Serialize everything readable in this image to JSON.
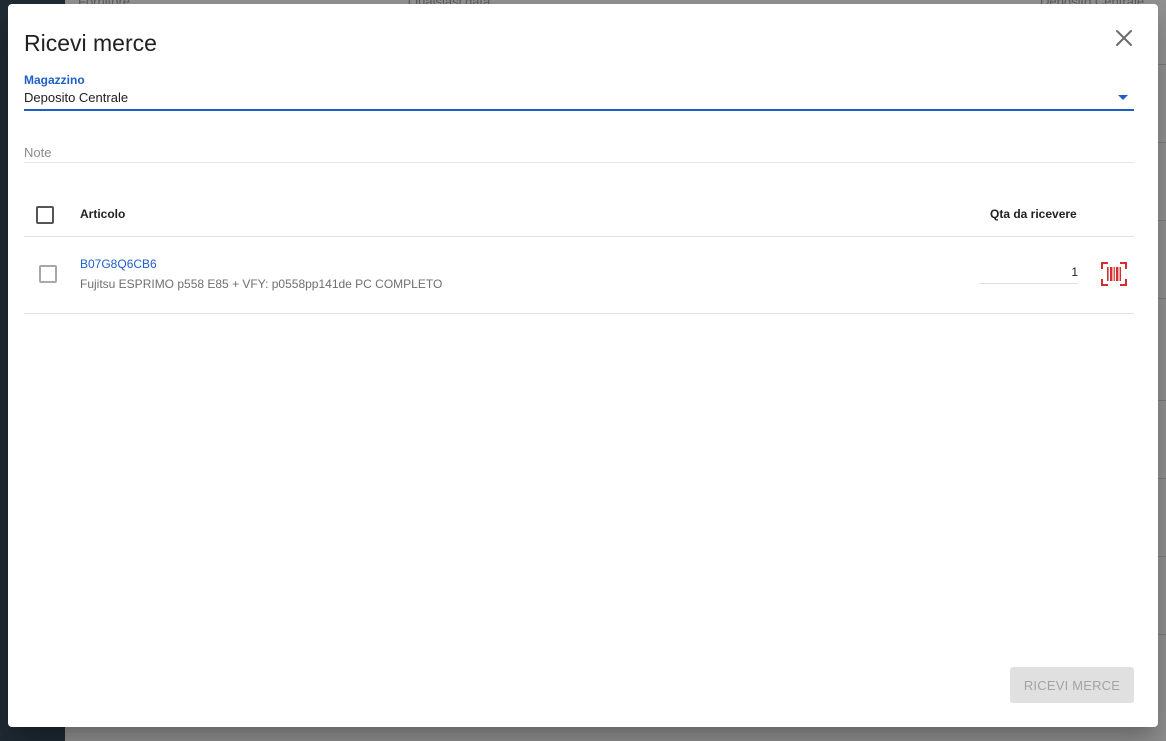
{
  "background": {
    "left_text": "Fornitore",
    "center_text": "Qualsiasi data",
    "right_text": "Deposito Centrale"
  },
  "dialog": {
    "title": "Ricevi merce",
    "close_icon": "close-icon",
    "warehouse": {
      "label": "Magazzino",
      "value": "Deposito Centrale"
    },
    "note": {
      "placeholder": "Note",
      "value": ""
    },
    "table": {
      "headers": {
        "article": "Articolo",
        "qty": "Qta da ricevere"
      },
      "rows": [
        {
          "sku": "B07G8Q6CB6",
          "description": "Fujitsu ESPRIMO p558 E85 + VFY: p0558pp141de PC COMPLETO",
          "qty": "1",
          "scan_icon": "barcode-scan-icon"
        }
      ]
    },
    "submit_label": "RICEVI MERCE"
  },
  "colors": {
    "accent": "#1e5ec8",
    "barcode": "#d32f2f",
    "disabled_bg": "#e0e0e0",
    "disabled_text": "#a3a3a3"
  }
}
